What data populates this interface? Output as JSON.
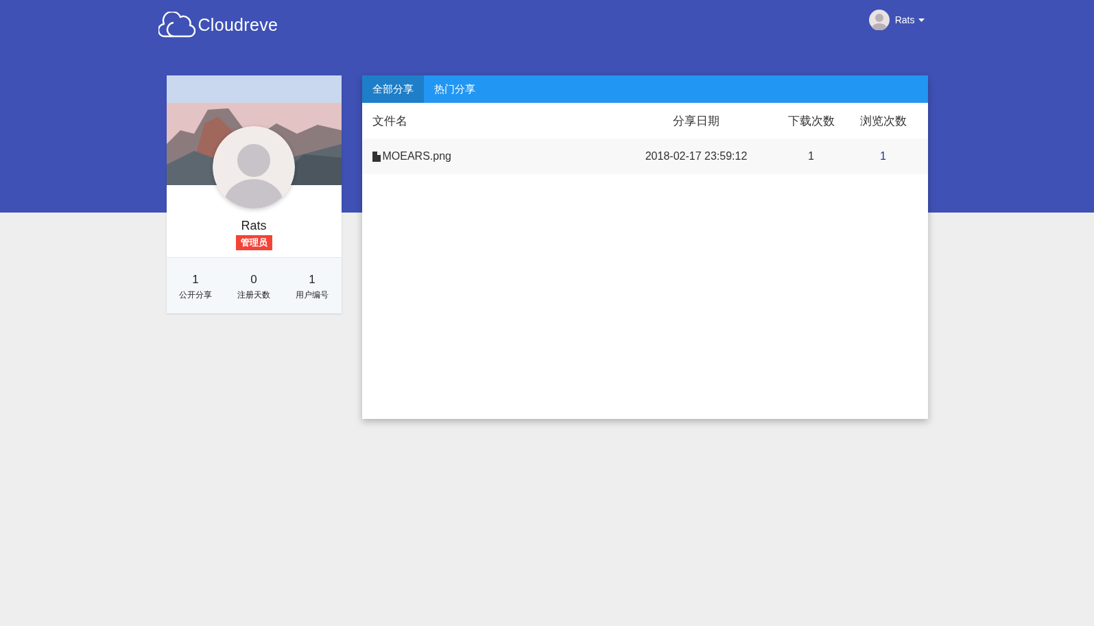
{
  "header": {
    "logo": "Cloudreve",
    "user": {
      "name": "Rats"
    }
  },
  "profile": {
    "name": "Rats",
    "badge": "管理员",
    "stats": [
      {
        "value": "1",
        "label": "公开分享"
      },
      {
        "value": "0",
        "label": "注册天数"
      },
      {
        "value": "1",
        "label": "用户编号"
      }
    ]
  },
  "tabs": [
    {
      "label": "全部分享",
      "selected": true
    },
    {
      "label": "热门分享",
      "selected": false
    }
  ],
  "table": {
    "columns": [
      "文件名",
      "分享日期",
      "下载次数",
      "浏览次数"
    ],
    "rows": [
      {
        "name": "MOEARS.png",
        "date": "2018-02-17 23:59:12",
        "downloads": "1",
        "views": "1"
      }
    ]
  }
}
